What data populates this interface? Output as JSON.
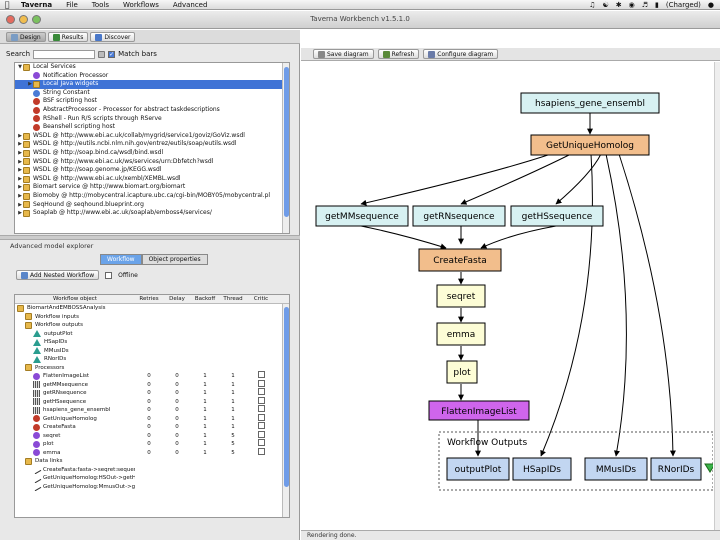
{
  "menubar": {
    "items": [
      "Taverna",
      "File",
      "Tools",
      "Workflows",
      "Advanced"
    ],
    "charged": "(Charged)"
  },
  "window": {
    "title": "Taverna Workbench v1.5.1.0"
  },
  "left_toolbar": {
    "design": "Design",
    "results": "Results",
    "discover": "Discover"
  },
  "search": {
    "label": "Search",
    "match_label": "Match bars"
  },
  "services": [
    {
      "label": "Local Services",
      "indent": 0,
      "open": true,
      "kind": "folder"
    },
    {
      "label": "Notification Processor",
      "indent": 1,
      "kind": "purple"
    },
    {
      "label": "Local Java widgets",
      "indent": 1,
      "kind": "folder",
      "selected": true
    },
    {
      "label": "String Constant",
      "indent": 1,
      "kind": "blue"
    },
    {
      "label": "BSF scripting host",
      "indent": 1,
      "kind": "red"
    },
    {
      "label": "AbstractProcessor - Processor for abstract taskdescriptions",
      "indent": 1,
      "kind": "red"
    },
    {
      "label": "RShell - Run R/S scripts through RServe",
      "indent": 1,
      "kind": "red"
    },
    {
      "label": "Beanshell scripting host",
      "indent": 1,
      "kind": "red"
    },
    {
      "label": "WSDL @ http://www.ebi.ac.uk/collab/mygrid/service1/goviz/GoViz.wsdl",
      "indent": 0,
      "kind": "folder"
    },
    {
      "label": "WSDL @ http://eutils.ncbi.nlm.nih.gov/entrez/eutils/soap/eutils.wsdl",
      "indent": 0,
      "kind": "folder"
    },
    {
      "label": "WSDL @ http://soap.bind.ca/wsdl/bind.wsdl",
      "indent": 0,
      "kind": "folder"
    },
    {
      "label": "WSDL @ http://www.ebi.ac.uk/ws/services/urn:Dbfetch?wsdl",
      "indent": 0,
      "kind": "folder"
    },
    {
      "label": "WSDL @ http://soap.genome.jp/KEGG.wsdl",
      "indent": 0,
      "kind": "folder"
    },
    {
      "label": "WSDL @ http://www.ebi.ac.uk/xembl/XEMBL.wsdl",
      "indent": 0,
      "kind": "folder"
    },
    {
      "label": "Biomart service @ http://www.biomart.org/biomart",
      "indent": 0,
      "kind": "folder"
    },
    {
      "label": "Biomoby @ http://mobycentral.icapture.ubc.ca/cgi-bin/MOBY05/mobycentral.pl",
      "indent": 0,
      "kind": "folder"
    },
    {
      "label": "SeqHound @ seqhound.blueprint.org",
      "indent": 0,
      "kind": "folder"
    },
    {
      "label": "Soaplab @ http://www.ebi.ac.uk/soaplab/emboss4/services/",
      "indent": 0,
      "kind": "folder"
    }
  ],
  "explorer": {
    "title": "Advanced model explorer",
    "tabs": [
      "Workflow",
      "Object properties"
    ],
    "add_nested": "Add Nested Workflow",
    "offline": "Offline",
    "columns": [
      "Workflow object",
      "Retries",
      "Delay",
      "Backoff",
      "Thread",
      "Critic"
    ],
    "rows": [
      {
        "name": "BiomartAndEMBOSSAnalysis",
        "indent": 0,
        "kind": "folder",
        "vals": [
          "",
          "",
          "",
          "",
          ""
        ]
      },
      {
        "name": "Workflow inputs",
        "indent": 1,
        "kind": "folder",
        "vals": [
          "",
          "",
          "",
          "",
          ""
        ]
      },
      {
        "name": "Workflow outputs",
        "indent": 1,
        "kind": "folder",
        "vals": [
          "",
          "",
          "",
          "",
          ""
        ]
      },
      {
        "name": "outputPlot",
        "indent": 2,
        "kind": "tri",
        "vals": [
          "",
          "",
          "",
          "",
          ""
        ]
      },
      {
        "name": "HSapIDs",
        "indent": 2,
        "kind": "tri",
        "vals": [
          "",
          "",
          "",
          "",
          ""
        ]
      },
      {
        "name": "MMusIDs",
        "indent": 2,
        "kind": "tri",
        "vals": [
          "",
          "",
          "",
          "",
          ""
        ]
      },
      {
        "name": "RNorIDs",
        "indent": 2,
        "kind": "tri",
        "vals": [
          "",
          "",
          "",
          "",
          ""
        ]
      },
      {
        "name": "Processors",
        "indent": 1,
        "kind": "folder",
        "vals": [
          "",
          "",
          "",
          "",
          ""
        ]
      },
      {
        "name": "FlattenImageList",
        "indent": 2,
        "kind": "purple",
        "vals": [
          "0",
          "0",
          "1",
          "1",
          "box"
        ]
      },
      {
        "name": "getMMsequence",
        "indent": 2,
        "kind": "grid",
        "vals": [
          "0",
          "0",
          "1",
          "1",
          "box"
        ]
      },
      {
        "name": "getRNsequence",
        "indent": 2,
        "kind": "grid",
        "vals": [
          "0",
          "0",
          "1",
          "1",
          "box"
        ]
      },
      {
        "name": "getHSsequence",
        "indent": 2,
        "kind": "grid",
        "vals": [
          "0",
          "0",
          "1",
          "1",
          "box"
        ]
      },
      {
        "name": "hsapiens_gene_ensembl",
        "indent": 2,
        "kind": "grid",
        "vals": [
          "0",
          "0",
          "1",
          "1",
          "box"
        ]
      },
      {
        "name": "GetUniqueHomolog",
        "indent": 2,
        "kind": "red",
        "vals": [
          "0",
          "0",
          "1",
          "1",
          "box"
        ]
      },
      {
        "name": "CreateFasta",
        "indent": 2,
        "kind": "red",
        "vals": [
          "0",
          "0",
          "1",
          "1",
          "box"
        ]
      },
      {
        "name": "seqret",
        "indent": 2,
        "kind": "purple",
        "vals": [
          "0",
          "0",
          "1",
          "5",
          "box"
        ]
      },
      {
        "name": "plot",
        "indent": 2,
        "kind": "purple",
        "vals": [
          "0",
          "0",
          "1",
          "5",
          "box"
        ]
      },
      {
        "name": "emma",
        "indent": 2,
        "kind": "purple",
        "vals": [
          "0",
          "0",
          "1",
          "5",
          "box"
        ]
      },
      {
        "name": "Data links",
        "indent": 1,
        "kind": "folder",
        "vals": [
          "",
          "",
          "",
          "",
          ""
        ]
      },
      {
        "name": "CreateFasta:fasta->seqret:sequen",
        "indent": 2,
        "kind": "link",
        "vals": [
          "",
          "",
          "",
          "",
          ""
        ]
      },
      {
        "name": "GetUniqueHomolog:HSOut->getHS",
        "indent": 2,
        "kind": "link",
        "vals": [
          "",
          "",
          "",
          "",
          ""
        ]
      },
      {
        "name": "GetUniqueHomolog:MmusOut->ge",
        "indent": 2,
        "kind": "link",
        "vals": [
          "",
          "",
          "",
          "",
          ""
        ]
      }
    ]
  },
  "diagram_toolbar": {
    "save": "Save diagram",
    "refresh": "Refresh",
    "configure": "Configure diagram"
  },
  "diagram": {
    "nodes": {
      "hsapiens": "hsapiens_gene_ensembl",
      "homolog": "GetUniqueHomolog",
      "mm": "getMMsequence",
      "rn": "getRNsequence",
      "hs": "getHSsequence",
      "fasta": "CreateFasta",
      "seqret": "seqret",
      "emma": "emma",
      "plot": "plot",
      "flatten": "FlattenImageList"
    },
    "outputs_label": "Workflow Outputs",
    "outputs": [
      "outputPlot",
      "HSapIDs",
      "MMusIDs",
      "RNorIDs"
    ]
  },
  "status": "Rendering done.",
  "colors": {
    "ws_node": "#d7f1f2",
    "local_node": "#f2be8c",
    "emboss_node": "#fdfdd6",
    "flatten_node": "#cf65ec",
    "output_node": "#c2d6f1",
    "selection": "#3f73d6"
  }
}
